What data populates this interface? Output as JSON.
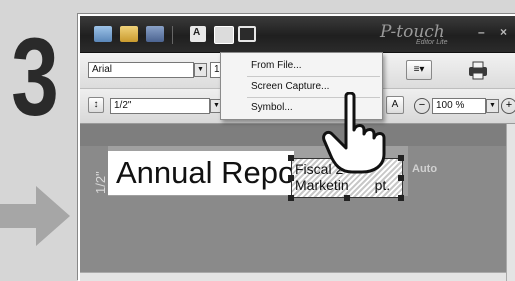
{
  "step": {
    "number": "3"
  },
  "toolbar": {
    "font_name": "Arial",
    "font_size_partial": "1",
    "length": "1/2\"",
    "zoom": "100 %",
    "aa_label": "A",
    "align_label": "A"
  },
  "app": {
    "logo": "P-touch",
    "logo_sub": "Editor Lite"
  },
  "menu": {
    "items": [
      {
        "label": "From File..."
      },
      {
        "label": "Screen Capture..."
      },
      {
        "label": "Symbol..."
      }
    ]
  },
  "canvas": {
    "ruler_label": "1/2\"",
    "annual_text": "Annual Repor",
    "fiscal_line1": "Fiscal 2",
    "fiscal_line2": "Marketin",
    "fiscal_tail": "pt.",
    "auto_label": "Auto"
  },
  "colors": {
    "titlebar": "#2b2b2b",
    "canvas": "#8a8a8a",
    "step_text": "#2a2a2a",
    "arrow": "#a6a6a6"
  }
}
